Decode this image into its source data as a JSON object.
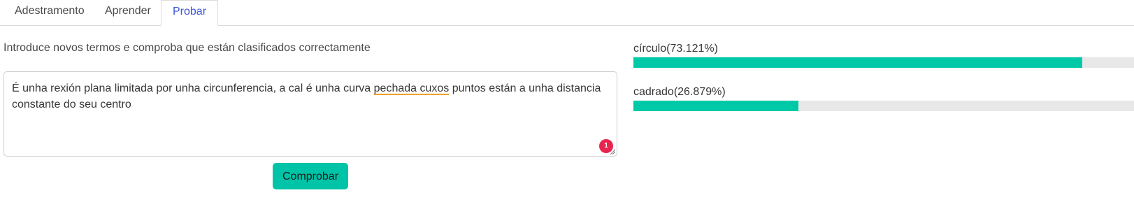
{
  "tabs": [
    {
      "label": "Adestramento",
      "active": false
    },
    {
      "label": "Aprender",
      "active": false
    },
    {
      "label": "Probar",
      "active": true
    }
  ],
  "intro_text": "Introduce novos termos e comproba que están clasificados correctamente",
  "input": {
    "value_parts": [
      "É unha rexión plana limitada por unha circunferencia, a cal é unha curva ",
      "pechada cuxos",
      " puntos están a unha distancia constante do seu centro"
    ],
    "issue_count": "1"
  },
  "submit_label": "Comprobar",
  "results": [
    {
      "label": "círculo(73.121%)",
      "value": 0.73121
    },
    {
      "label": "cadrado(26.879%)",
      "value": 0.26879
    }
  ],
  "colors": {
    "accent": "#00c9a7",
    "active_tab": "#3e56d6",
    "badge": "#e8254f",
    "spell_underline": "#f0a32c"
  }
}
